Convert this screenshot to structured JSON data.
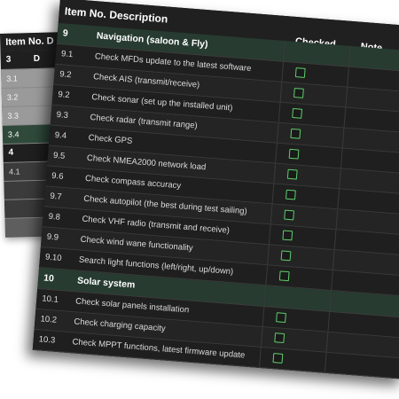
{
  "back": {
    "header": "Item No. D",
    "rows": [
      {
        "no": "3",
        "d": "D",
        "type": "sec"
      },
      {
        "no": "3.1",
        "d": "",
        "type": "gray"
      },
      {
        "no": "3.2",
        "d": "",
        "type": "gray"
      },
      {
        "no": "3.3",
        "d": "",
        "type": "gray"
      },
      {
        "no": "3.4",
        "d": "",
        "type": "hl"
      },
      {
        "no": "4",
        "d": "",
        "type": "sec"
      },
      {
        "no": "4.1",
        "d": "",
        "type": "dk"
      },
      {
        "no": "",
        "d": "",
        "type": "dk"
      },
      {
        "no": "",
        "d": "",
        "type": "dk"
      }
    ]
  },
  "main": {
    "header_item_desc": "Item No. Description",
    "header_checked": "Checked",
    "header_note": "Note",
    "sections": [
      {
        "no": "9",
        "title": "Navigation (saloon & Fly)",
        "items": [
          {
            "no": "9.1",
            "desc": "Check MFDs update to the latest software"
          },
          {
            "no": "9.2",
            "desc": "Check AIS (transmit/receive)"
          },
          {
            "no": "9.2",
            "desc": "Check sonar (set up the installed unit)"
          },
          {
            "no": "9.3",
            "desc": "Check radar (transmit range)"
          },
          {
            "no": "9.4",
            "desc": "Check GPS"
          },
          {
            "no": "9.5",
            "desc": "Check NMEA2000 network load"
          },
          {
            "no": "9.6",
            "desc": "Check compass accuracy"
          },
          {
            "no": "9.7",
            "desc": "Check autopilot (the best during test sailing)"
          },
          {
            "no": "9.8",
            "desc": "Check VHF radio (transmit and receive)"
          },
          {
            "no": "9.9",
            "desc": "Check wind wane functionality"
          },
          {
            "no": "9.10",
            "desc": "Search light functions (left/right, up/down)"
          }
        ]
      },
      {
        "no": "10",
        "title": "Solar system",
        "items": [
          {
            "no": "10.1",
            "desc": "Check solar panels installation"
          },
          {
            "no": "10.2",
            "desc": "Check charging capacity"
          },
          {
            "no": "10.3",
            "desc": "Check MPPT functions, latest firmware update"
          }
        ]
      }
    ]
  },
  "colors": {
    "accent": "#5fcf6a",
    "section_bg": "#273b30",
    "sheet_bg": "#1b1b1b"
  }
}
